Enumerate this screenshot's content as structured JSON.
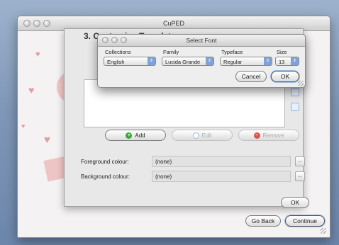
{
  "app": {
    "window_title": "CuPED"
  },
  "sheet": {
    "heading": "3. Customise Template",
    "buttons": {
      "add": "Add",
      "edit": "Edit",
      "remove": "Remove"
    },
    "foreground": {
      "label": "Foreground colour:",
      "value": "(none)",
      "picker": "..."
    },
    "background": {
      "label": "Background colour:",
      "value": "(none)",
      "picker": "..."
    },
    "ok": "OK"
  },
  "footer": {
    "go_back": "Go Back",
    "continue": "Continue"
  },
  "font_dialog": {
    "title": "Select Font",
    "columns": {
      "collections": {
        "label": "Collections",
        "value": "English"
      },
      "family": {
        "label": "Family",
        "value": "Lucida Grande"
      },
      "typeface": {
        "label": "Typeface",
        "value": "Regular"
      },
      "size": {
        "label": "Size",
        "value": "13"
      }
    },
    "cancel": "Cancel",
    "ok": "OK"
  },
  "colors": {
    "accent": "#7fa3d6",
    "add_icon": "#38a43a",
    "remove_icon": "#d9534f",
    "decor_pink": "#efc4c4"
  }
}
